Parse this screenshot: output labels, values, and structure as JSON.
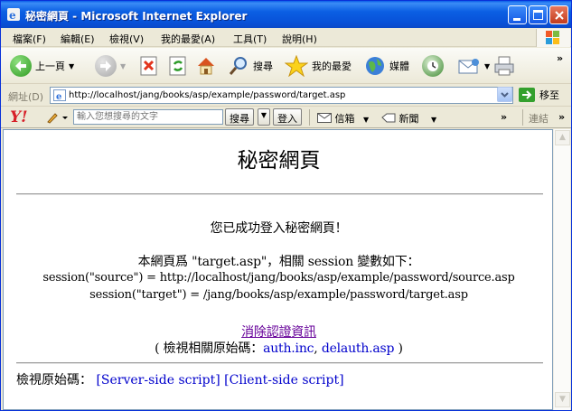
{
  "window": {
    "title": "秘密網頁 - Microsoft Internet Explorer"
  },
  "menu": [
    "檔案(F)",
    "編輯(E)",
    "檢視(V)",
    "我的最愛(A)",
    "工具(T)",
    "說明(H)"
  ],
  "toolbar": {
    "back_label": "上一頁",
    "search_label": "搜尋",
    "favorites_label": "我的最愛",
    "media_label": "媒體"
  },
  "address": {
    "label": "網址(D)",
    "value": "http://localhost/jang/books/asp/example/password/target.asp",
    "go_label": "移至"
  },
  "yahoo": {
    "logo": "Y!",
    "search_placeholder": "輸入您想搜尋的文字",
    "search_button": "搜尋",
    "login_button": "登入",
    "mail_label": "信箱",
    "news_label": "新聞",
    "links_label": "連結"
  },
  "page": {
    "title": "秘密網頁",
    "success_msg": "您已成功登入秘密網頁！",
    "session_intro": "本網頁爲 \"target.asp\"，相關 session 變數如下：",
    "session_source": "session(\"source\") = http://localhost/jang/books/asp/example/password/source.asp",
    "session_target": "session(\"target\") = /jang/books/asp/example/password/target.asp",
    "clear_link": "消除認證資訊",
    "related_prefix": "( 檢視相關原始碼：",
    "related_link1": "auth.inc",
    "related_sep": ", ",
    "related_link2": "delauth.asp",
    "related_suffix": " )",
    "view_source_label": "檢視原始碼：",
    "server_script_link": "[Server-side script]",
    "client_script_link": "[Client-side script]"
  },
  "colors": {
    "titlebar": "#0a5ee8",
    "link": "#0000cc",
    "visited_link": "#660099"
  }
}
